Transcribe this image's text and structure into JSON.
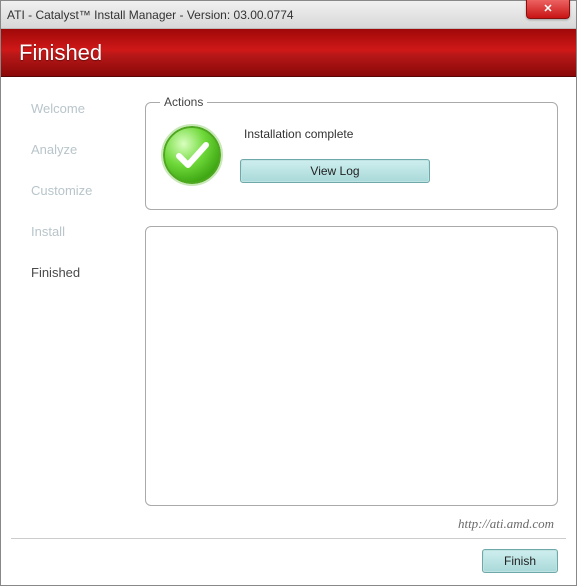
{
  "window": {
    "title": "ATI - Catalyst™ Install Manager - Version: 03.00.0774",
    "close_glyph": "✕"
  },
  "header": {
    "title": "Finished"
  },
  "sidebar": {
    "items": [
      {
        "label": "Welcome",
        "active": false
      },
      {
        "label": "Analyze",
        "active": false
      },
      {
        "label": "Customize",
        "active": false
      },
      {
        "label": "Install",
        "active": false
      },
      {
        "label": "Finished",
        "active": true
      }
    ]
  },
  "actions": {
    "legend": "Actions",
    "message": "Installation complete",
    "view_log_label": "View Log"
  },
  "footer": {
    "url": "http://ati.amd.com",
    "finish_label": "Finish"
  }
}
